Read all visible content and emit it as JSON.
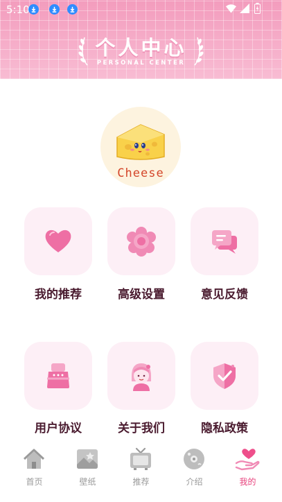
{
  "status_bar": {
    "time": "5:10",
    "notification_icons": [
      "download-icon",
      "download-icon",
      "download-icon"
    ],
    "system_icons": [
      "wifi-icon",
      "signal-icon",
      "battery-icon"
    ]
  },
  "header": {
    "title": "个人中心",
    "subtitle": "PERSONAL CENTER"
  },
  "profile": {
    "avatar_icon": "cheese-icon",
    "avatar_text": "Cheese"
  },
  "menu": [
    {
      "label": "我的推荐",
      "icon": "heart-icon"
    },
    {
      "label": "高级设置",
      "icon": "flower-icon"
    },
    {
      "label": "意见反馈",
      "icon": "chat-icon"
    },
    {
      "label": "用户协议",
      "icon": "bag-icon"
    },
    {
      "label": "关于我们",
      "icon": "girl-icon"
    },
    {
      "label": "隐私政策",
      "icon": "shield-icon"
    }
  ],
  "tabbar": {
    "tabs": [
      {
        "label": "首页",
        "icon": "home-icon",
        "active": false
      },
      {
        "label": "壁纸",
        "icon": "wallpaper-icon",
        "active": false
      },
      {
        "label": "推荐",
        "icon": "tv-icon",
        "active": false
      },
      {
        "label": "介绍",
        "icon": "disc-icon",
        "active": false
      },
      {
        "label": "我的",
        "icon": "hand-heart-icon",
        "active": true
      }
    ]
  },
  "colors": {
    "header_pink": "#f7b6cf",
    "card_bg": "#fdeff6",
    "icon_pink": "#ee6fa4",
    "label_dark": "#4a1b2f",
    "tab_active": "#e8437e",
    "tab_inactive": "#9a9a9a"
  }
}
